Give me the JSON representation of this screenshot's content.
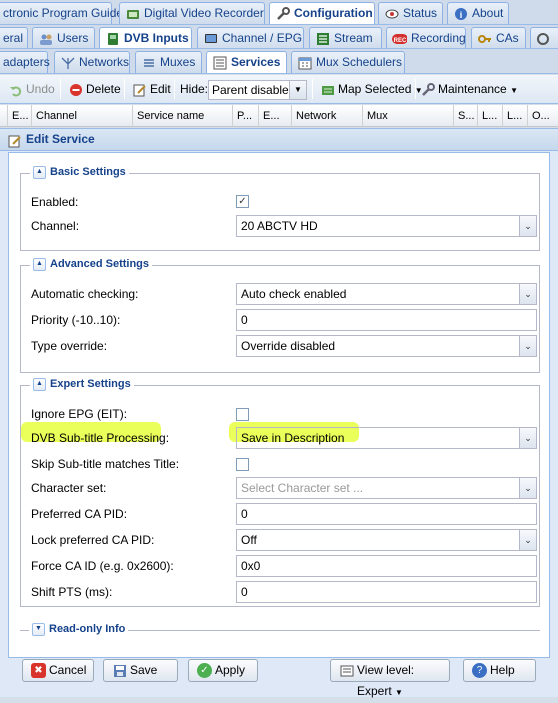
{
  "top_tabs": [
    {
      "label": "ctronic Program Guide",
      "icon": "none",
      "active": false
    },
    {
      "label": "Digital Video Recorder",
      "icon": "dvr-icon",
      "active": false
    },
    {
      "label": "Configuration",
      "icon": "wrench-icon",
      "active": true
    },
    {
      "label": "Status",
      "icon": "eye-icon",
      "active": false
    },
    {
      "label": "About",
      "icon": "info-icon",
      "active": false
    }
  ],
  "config_tabs": [
    {
      "label": "eral",
      "icon": "none",
      "active": false
    },
    {
      "label": "Users",
      "icon": "users-icon",
      "active": false
    },
    {
      "label": "DVB Inputs",
      "icon": "dvb-icon",
      "active": true
    },
    {
      "label": "Channel / EPG",
      "icon": "tv-icon",
      "active": false
    },
    {
      "label": "Stream",
      "icon": "stream-icon",
      "active": false
    },
    {
      "label": "Recording",
      "icon": "rec-icon",
      "active": false
    },
    {
      "label": "CAs",
      "icon": "key-icon",
      "active": false
    }
  ],
  "dvb_tabs": [
    {
      "label": "adapters",
      "icon": "none",
      "active": false
    },
    {
      "label": "Networks",
      "icon": "antenna-icon",
      "active": false
    },
    {
      "label": "Muxes",
      "icon": "mux-icon",
      "active": false
    },
    {
      "label": "Services",
      "icon": "services-icon",
      "active": true
    },
    {
      "label": "Mux Schedulers",
      "icon": "scheduler-icon",
      "active": false
    }
  ],
  "toolbar": {
    "undo_label": "Undo",
    "delete_label": "Delete",
    "edit_label": "Edit",
    "hide_label": "Hide:",
    "hide_value": "Parent disabled",
    "map_label": "Map Selected",
    "maintenance_label": "Maintenance"
  },
  "grid_columns": [
    "E...",
    "Channel",
    "Service name",
    "P...",
    "E...",
    "Network",
    "Mux",
    "S...",
    "L...",
    "L...",
    "O..."
  ],
  "dialog": {
    "title": "Edit Service",
    "basic": {
      "legend": "Basic Settings",
      "enabled_label": "Enabled:",
      "enabled_checked": true,
      "channel_label": "Channel:",
      "channel_value": "20 ABCTV HD"
    },
    "advanced": {
      "legend": "Advanced Settings",
      "auto_check_label": "Automatic checking:",
      "auto_check_value": "Auto check enabled",
      "priority_label": "Priority (-10..10):",
      "priority_value": "0",
      "type_override_label": "Type override:",
      "type_override_value": "Override disabled"
    },
    "expert": {
      "legend": "Expert Settings",
      "ignore_epg_label": "Ignore EPG (EIT):",
      "ignore_epg_checked": false,
      "subtitle_label": "DVB Sub-title Processing:",
      "subtitle_value": "Save in Description",
      "skip_subtitle_label": "Skip Sub-title matches Title:",
      "skip_subtitle_checked": false,
      "charset_label": "Character set:",
      "charset_placeholder": "Select Character set ...",
      "ca_pid_label": "Preferred CA PID:",
      "ca_pid_value": "0",
      "lock_ca_label": "Lock preferred CA PID:",
      "lock_ca_value": "Off",
      "force_ca_label": "Force CA ID (e.g. 0x2600):",
      "force_ca_value": "0x0",
      "shift_pts_label": "Shift PTS (ms):",
      "shift_pts_value": "0"
    },
    "readonly": {
      "legend": "Read-only Info"
    },
    "buttons": {
      "cancel": "Cancel",
      "save": "Save",
      "apply": "Apply",
      "view_level": "View level: Expert",
      "help": "Help"
    }
  },
  "colors": {
    "accent": "#15428b",
    "highlight": "#e6ff3d",
    "tab_border": "#8db2e3"
  }
}
